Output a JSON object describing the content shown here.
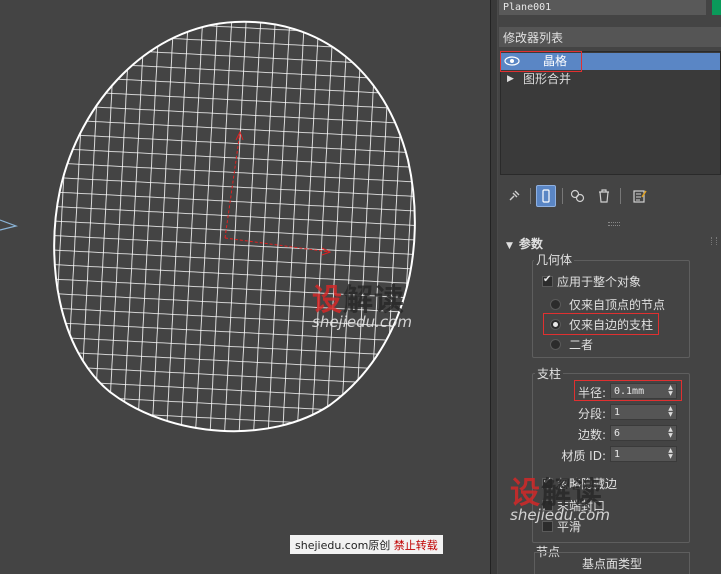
{
  "viewport": {
    "watermark_brand_red": "设",
    "watermark_brand_dark": "解读",
    "watermark_url": "shejiedu.com",
    "footer": {
      "site": "shejiedu.com原创",
      "notice": "禁止转载"
    }
  },
  "panel": {
    "object_name": "Plane001",
    "object_color": "#0a9a5a",
    "modifier_list_label": "修改器列表",
    "stack": {
      "selected": "晶格",
      "items": [
        "图形合并"
      ]
    },
    "toolbar": {
      "icons": [
        "pin-stack-icon",
        "show-end-result-icon",
        "make-unique-icon",
        "remove-modifier-icon",
        "configure-modifier-sets-icon"
      ]
    },
    "parameters": {
      "title": "参数",
      "geometry": {
        "label": "几何体",
        "apply_to_entire": "应用于整个对象",
        "apply_to_entire_checked": true,
        "options": [
          "仅来自顶点的节点",
          "仅来自边的支柱",
          "二者"
        ],
        "selected_option": "仅来自边的支柱"
      },
      "struts": {
        "label": "支柱",
        "radius_label": "半径:",
        "radius_value": "0.1mm",
        "segments_label": "分段:",
        "segments_value": "1",
        "sides_label": "边数:",
        "sides_value": "6",
        "material_id_label": "材质 ID:",
        "material_id_value": "1",
        "ignore_hidden_edges": "忽略隐藏边",
        "end_caps": "末端封口",
        "smooth": "平滑"
      },
      "joints": {
        "label": "节点",
        "base_geodesic_type": "基点面类型"
      }
    },
    "highlight_color": "#5a86c5",
    "annotation_color": "#e03030"
  }
}
